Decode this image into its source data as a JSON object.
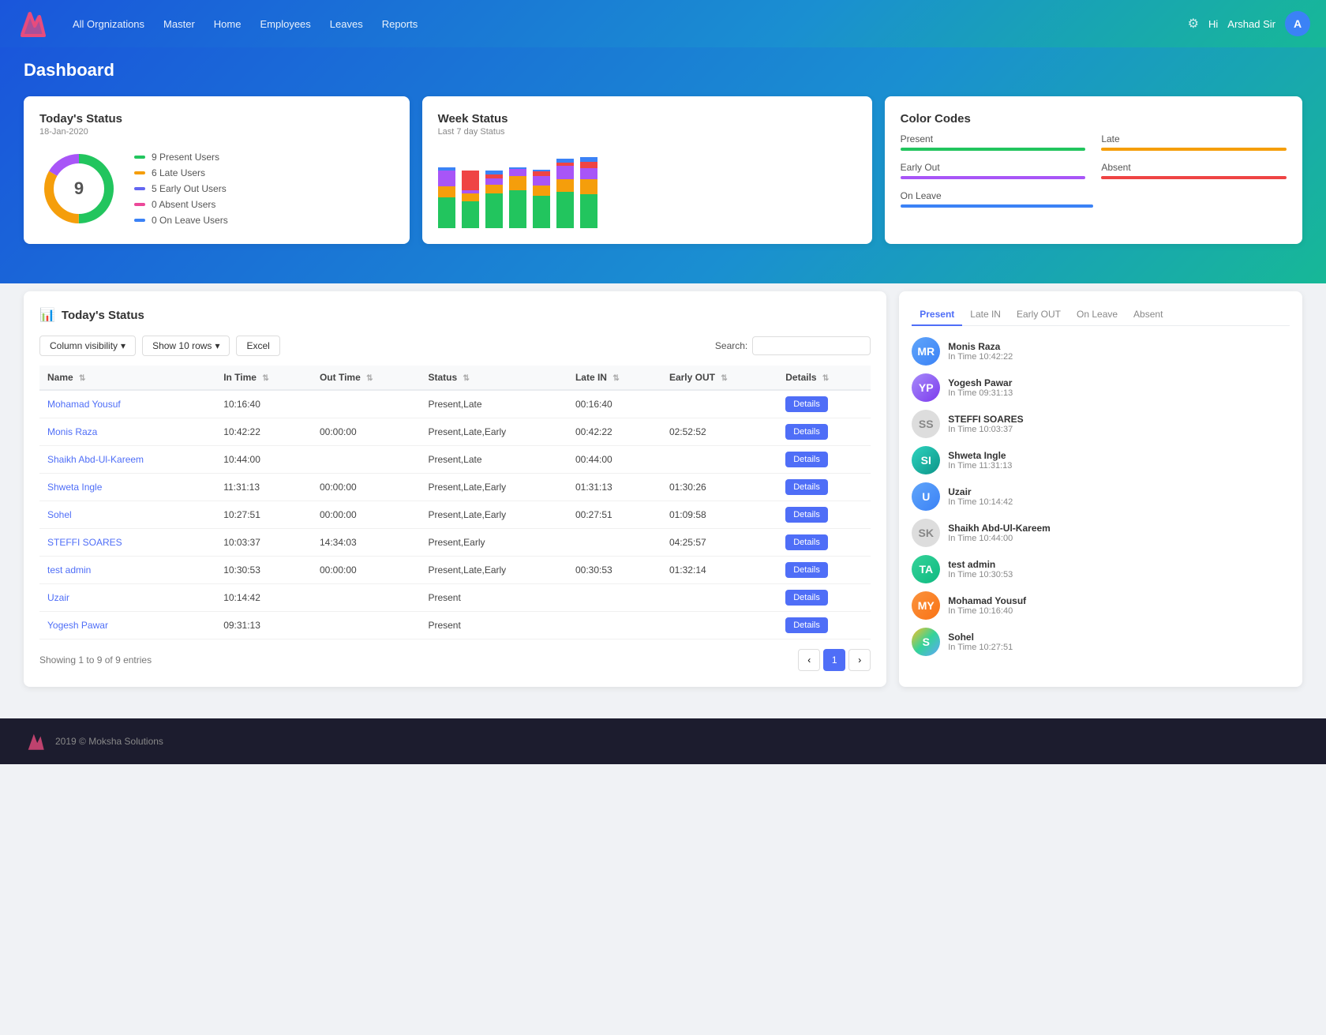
{
  "navbar": {
    "logo_text": "M",
    "links": [
      {
        "label": "All Orgnizations",
        "key": "all-orgs"
      },
      {
        "label": "Master",
        "key": "master"
      },
      {
        "label": "Home",
        "key": "home"
      },
      {
        "label": "Employees",
        "key": "employees"
      },
      {
        "label": "Leaves",
        "key": "leaves"
      },
      {
        "label": "Reports",
        "key": "reports"
      }
    ],
    "user_greeting": "Hi",
    "user_name": "Arshad Sir",
    "user_initial": "A"
  },
  "page_title": "Dashboard",
  "today_status_card": {
    "title": "Today's Status",
    "subtitle": "18-Jan-2020",
    "donut_center": "9",
    "legend": [
      {
        "color": "#22c55e",
        "label": "9 Present Users"
      },
      {
        "color": "#f59e0b",
        "label": "6 Late Users"
      },
      {
        "color": "#6366f1",
        "label": "5 Early Out Users"
      },
      {
        "color": "#ec4899",
        "label": "0 Absent Users"
      },
      {
        "color": "#3b82f6",
        "label": "0 On Leave Users"
      }
    ]
  },
  "week_status_card": {
    "title": "Week Status",
    "subtitle": "Last 7 day Status",
    "bars": [
      {
        "present": 40,
        "late": 15,
        "early": 20,
        "absent": 0,
        "leave": 5
      },
      {
        "present": 35,
        "late": 10,
        "early": 5,
        "absent": 25,
        "leave": 0
      },
      {
        "present": 45,
        "late": 12,
        "early": 8,
        "absent": 5,
        "leave": 5
      },
      {
        "present": 50,
        "late": 18,
        "early": 10,
        "absent": 0,
        "leave": 2
      },
      {
        "present": 42,
        "late": 14,
        "early": 12,
        "absent": 6,
        "leave": 3
      },
      {
        "present": 48,
        "late": 16,
        "early": 18,
        "absent": 4,
        "leave": 5
      },
      {
        "present": 44,
        "late": 20,
        "early": 15,
        "absent": 8,
        "leave": 6
      }
    ]
  },
  "color_codes_card": {
    "title": "Color Codes",
    "items": [
      {
        "label": "Present",
        "color": "#22c55e"
      },
      {
        "label": "Late",
        "color": "#f59e0b"
      },
      {
        "label": "Early Out",
        "color": "#a855f7"
      },
      {
        "label": "Absent",
        "color": "#ef4444"
      },
      {
        "label": "On Leave",
        "color": "#3b82f6"
      }
    ]
  },
  "table_section": {
    "title": "Today's Status",
    "controls": {
      "column_visibility": "Column visibility",
      "show_rows": "Show 10 rows",
      "excel": "Excel",
      "search_label": "Search:",
      "search_placeholder": ""
    },
    "columns": [
      "Name",
      "In Time",
      "Out Time",
      "Status",
      "Late IN",
      "Early OUT",
      "Details"
    ],
    "rows": [
      {
        "name": "Mohamad Yousuf",
        "in_time": "10:16:40",
        "out_time": "",
        "status": "Present,Late",
        "late_in": "00:16:40",
        "early_out": "",
        "has_details": true
      },
      {
        "name": "Monis Raza",
        "in_time": "10:42:22",
        "out_time": "00:00:00",
        "status": "Present,Late,Early",
        "late_in": "00:42:22",
        "early_out": "02:52:52",
        "has_details": true
      },
      {
        "name": "Shaikh Abd-Ul-Kareem",
        "in_time": "10:44:00",
        "out_time": "",
        "status": "Present,Late",
        "late_in": "00:44:00",
        "early_out": "",
        "has_details": true
      },
      {
        "name": "Shweta Ingle",
        "in_time": "11:31:13",
        "out_time": "00:00:00",
        "status": "Present,Late,Early",
        "late_in": "01:31:13",
        "early_out": "01:30:26",
        "has_details": true
      },
      {
        "name": "Sohel",
        "in_time": "10:27:51",
        "out_time": "00:00:00",
        "status": "Present,Late,Early",
        "late_in": "00:27:51",
        "early_out": "01:09:58",
        "has_details": true
      },
      {
        "name": "STEFFI SOARES",
        "in_time": "10:03:37",
        "out_time": "14:34:03",
        "status": "Present,Early",
        "late_in": "",
        "early_out": "04:25:57",
        "has_details": true
      },
      {
        "name": "test admin",
        "in_time": "10:30:53",
        "out_time": "00:00:00",
        "status": "Present,Late,Early",
        "late_in": "00:30:53",
        "early_out": "01:32:14",
        "has_details": true
      },
      {
        "name": "Uzair",
        "in_time": "10:14:42",
        "out_time": "",
        "status": "Present",
        "late_in": "",
        "early_out": "",
        "has_details": true
      },
      {
        "name": "Yogesh Pawar",
        "in_time": "09:31:13",
        "out_time": "",
        "status": "Present",
        "late_in": "",
        "early_out": "",
        "has_details": true
      }
    ],
    "footer_info": "Showing 1 to 9 of 9 entries",
    "details_btn_label": "Details",
    "pagination": {
      "current": 1,
      "prev": "‹",
      "next": "›"
    }
  },
  "side_panel": {
    "tabs": [
      "Present",
      "Late IN",
      "Early OUT",
      "On Leave",
      "Absent"
    ],
    "active_tab": "Present",
    "users": [
      {
        "name": "Monis Raza",
        "time": "In Time 10:42:22",
        "avatar": "MR",
        "color": "av-blue"
      },
      {
        "name": "Yogesh Pawar",
        "time": "In Time 09:31:13",
        "avatar": "YP",
        "color": "av-purple"
      },
      {
        "name": "STEFFI SOARES",
        "time": "In Time 10:03:37",
        "avatar": "SS",
        "color": "no-avatar"
      },
      {
        "name": "Shweta Ingle",
        "time": "In Time 11:31:13",
        "avatar": "SI",
        "color": "av-teal"
      },
      {
        "name": "Uzair",
        "time": "In Time 10:14:42",
        "avatar": "U",
        "color": "av-blue"
      },
      {
        "name": "Shaikh Abd-Ul-Kareem",
        "time": "In Time 10:44:00",
        "avatar": "SK",
        "color": "no-avatar"
      },
      {
        "name": "test admin",
        "time": "In Time 10:30:53",
        "avatar": "TA",
        "color": "av-green"
      },
      {
        "name": "Mohamad Yousuf",
        "time": "In Time 10:16:40",
        "avatar": "MY",
        "color": "av-orange"
      },
      {
        "name": "Sohel",
        "time": "In Time 10:27:51",
        "avatar": "S",
        "color": "av-multi"
      }
    ]
  },
  "footer": {
    "copy": "2019 © Moksha Solutions"
  }
}
